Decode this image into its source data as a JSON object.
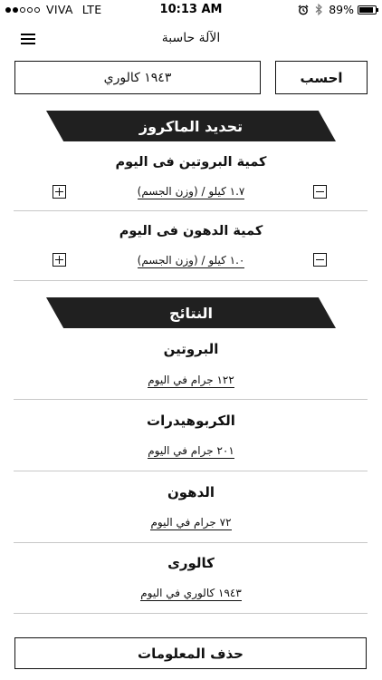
{
  "status_bar": {
    "carrier": "VIVA",
    "network": "LTE",
    "time": "10:13 AM",
    "battery": "89%",
    "battery_level": 0.89,
    "signal_strength": "2 of 5"
  },
  "header": {
    "title": "الآلة حاسبة"
  },
  "calculator": {
    "calculate_label": "احسب",
    "calories_value": "١٩٤٣ كالوري"
  },
  "macros_section": {
    "title": "تحديد الماكروز",
    "protein": {
      "label": "كمية البروتين فى اليوم",
      "value": "١.٧ كيلو / (وزن الجسم)"
    },
    "fat": {
      "label": "كمية الدهون فى اليوم",
      "value": "١.٠ كيلو / (وزن الجسم)"
    }
  },
  "results_section": {
    "title": "النتائج",
    "items": [
      {
        "label": "البروتين",
        "value": "١٢٢ جرام في اليوم"
      },
      {
        "label": "الكربوهيدرات",
        "value": "٢٠١ جرام في اليوم"
      },
      {
        "label": "الدهون",
        "value": "٧٢ جرام في اليوم"
      },
      {
        "label": "كالورى",
        "value": "١٩٤٣ كالوري في اليوم"
      }
    ]
  },
  "clear_label": "حذف المعلومات",
  "icons": {
    "menu": "hamburger-icon",
    "alarm": "alarm-clock-icon",
    "bluetooth": "bluetooth-icon",
    "battery": "battery-icon",
    "decrement": "minus-icon",
    "increment": "plus-icon"
  },
  "colors": {
    "banner": "#202020",
    "text": "#111111",
    "divider": "#c8c8c8",
    "background": "#ffffff"
  }
}
